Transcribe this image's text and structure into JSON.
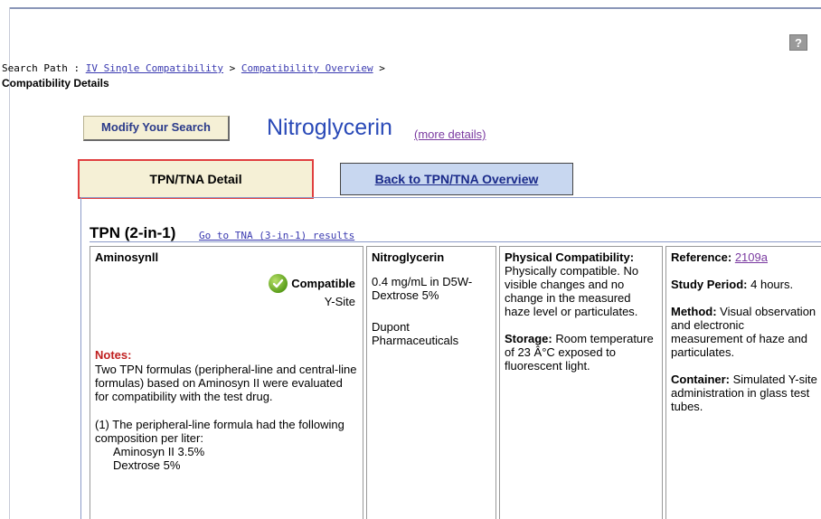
{
  "help": {
    "label": "?"
  },
  "breadcrumb": {
    "prefix": "Search Path : ",
    "link1": "IV Single Compatibility",
    "sep1": " > ",
    "link2": "Compatibility Overview",
    "sep2": " >",
    "current": "Compatibility Details"
  },
  "header": {
    "modify_label": "Modify Your Search",
    "drug_name": "Nitroglycerin",
    "more_details": "(more details)"
  },
  "tabs": {
    "active": "TPN/TNA Detail",
    "other": "Back to TPN/TNA Overview"
  },
  "section": {
    "title": "TPN (2-in-1)",
    "tna_link": "Go to TNA (3-in-1) results"
  },
  "row": {
    "solution": "Aminosynll",
    "status": "Compatible",
    "route": "Y-Site",
    "notes_title": "Notes:",
    "notes_p1": "Two TPN formulas (peripheral-line and central-line formulas) based on Aminosyn II were evaluated for compatibility with the test drug.",
    "notes_p2": "(1) The peripheral-line formula had the following composition per liter:",
    "notes_items": [
      "Aminosyn II 3.5%",
      "Dextrose 5%"
    ],
    "drug": "Nitroglycerin",
    "drug_conc": "0.4  mg/mL in D5W-Dextrose 5%",
    "manufacturer": "Dupont Pharmaceuticals",
    "phys_label": "Physical Compatibility:",
    "phys_text": " Physically compatible. No visible changes and no change in the measured haze level or particulates.",
    "storage_label": "Storage:",
    "storage_text": " Room temperature of 23 Â°C exposed to fluorescent light.",
    "ref_label": "Reference:",
    "ref_value": "2109a",
    "study_label": "Study Period:",
    "study_text": " 4 hours.",
    "method_label": "Method:",
    "method_text": " Visual observation and electronic measurement of haze and particulates.",
    "container_label": "Container:",
    "container_text": " Simulated Y-site administration in glass test tubes."
  }
}
